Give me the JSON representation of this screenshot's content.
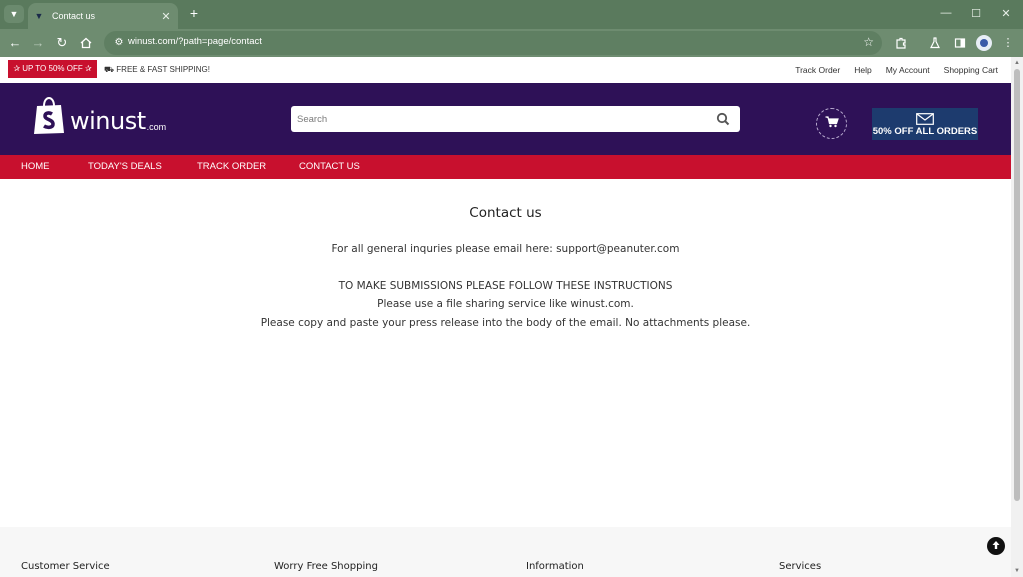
{
  "browser": {
    "tab_title": "Contact us",
    "url": "winust.com/?path=page/contact"
  },
  "topbar": {
    "promo": "✰ UP TO 50% OFF ✰",
    "shipping": "⛟ FREE & FAST SHIPPING!",
    "links": [
      "Track Order",
      "Help",
      "My Account",
      "Shopping Cart"
    ]
  },
  "header": {
    "logo_word": "winust",
    "logo_suffix": ".com",
    "search_placeholder": "Search",
    "offer_text": "50% OFF ALL ORDERS"
  },
  "nav": {
    "items": [
      "HOME",
      "TODAY'S DEALS",
      "TRACK ORDER",
      "CONTACT US"
    ]
  },
  "content": {
    "title": "Contact us",
    "line1": "For all general inquries please email here: support@peanuter.com",
    "line2": "TO MAKE SUBMISSIONS PLEASE FOLLOW THESE INSTRUCTIONS",
    "line3": "Please use a file sharing service like winust.com.",
    "line4": "Please copy and paste your press release into the body of the email. No attachments please."
  },
  "footer": {
    "columns": [
      "Customer Service",
      "Worry Free Shopping",
      "Information",
      "Services"
    ]
  },
  "colors": {
    "header_bg": "#2e1157",
    "nav_bg": "#c8102e",
    "promo_bg": "#c8102e",
    "offer_bg": "#1d3b6e",
    "browser_frame": "#5a7a5d"
  }
}
